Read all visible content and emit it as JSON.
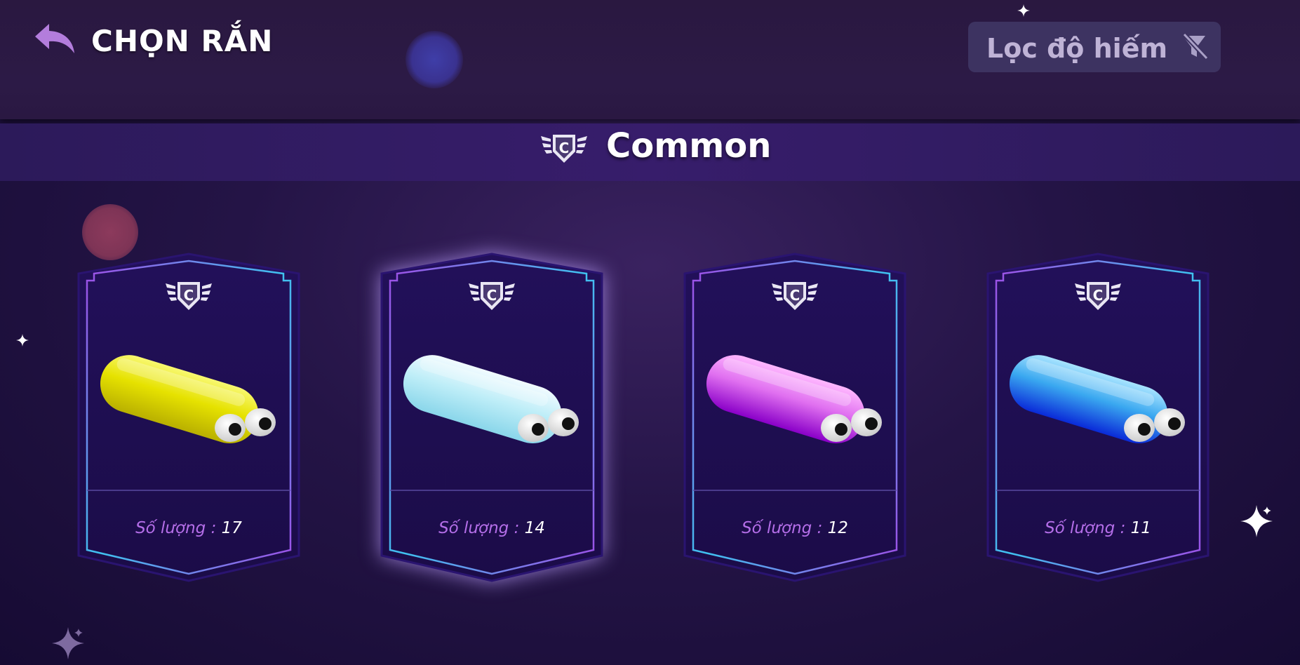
{
  "header": {
    "title": "CHỌN RẮN",
    "filter_label": "Lọc độ hiếm"
  },
  "section": {
    "rarity_title": "Common",
    "badge_letter": "C"
  },
  "cards": [
    {
      "qty_label": "Số lượng :",
      "qty_value": "17",
      "selected": false,
      "color_light": "#f8f870",
      "color_main": "#e6e200",
      "color_dark": "#b9b000"
    },
    {
      "qty_label": "Số lượng :",
      "qty_value": "14",
      "selected": true,
      "color_light": "#f2fbff",
      "color_main": "#bfeef8",
      "color_dark": "#8ad6ea"
    },
    {
      "qty_label": "Số lượng :",
      "qty_value": "12",
      "selected": false,
      "color_light": "#ffb8ff",
      "color_main": "#e070f0",
      "color_dark": "#8a00c8"
    },
    {
      "qty_label": "Số lượng :",
      "qty_value": "11",
      "selected": false,
      "color_light": "#a8e4ff",
      "color_main": "#3aa8f0",
      "color_dark": "#0a2ad8"
    }
  ],
  "colors": {
    "accent": "#b46ee8",
    "card_bg": "#241058",
    "frame_cyan": "#3fc2f0",
    "frame_violet": "#a14be6"
  },
  "icons": {
    "back": "back-arrow-icon",
    "filter": "filter-off-icon",
    "rarity": "common-rarity-badge-icon"
  }
}
